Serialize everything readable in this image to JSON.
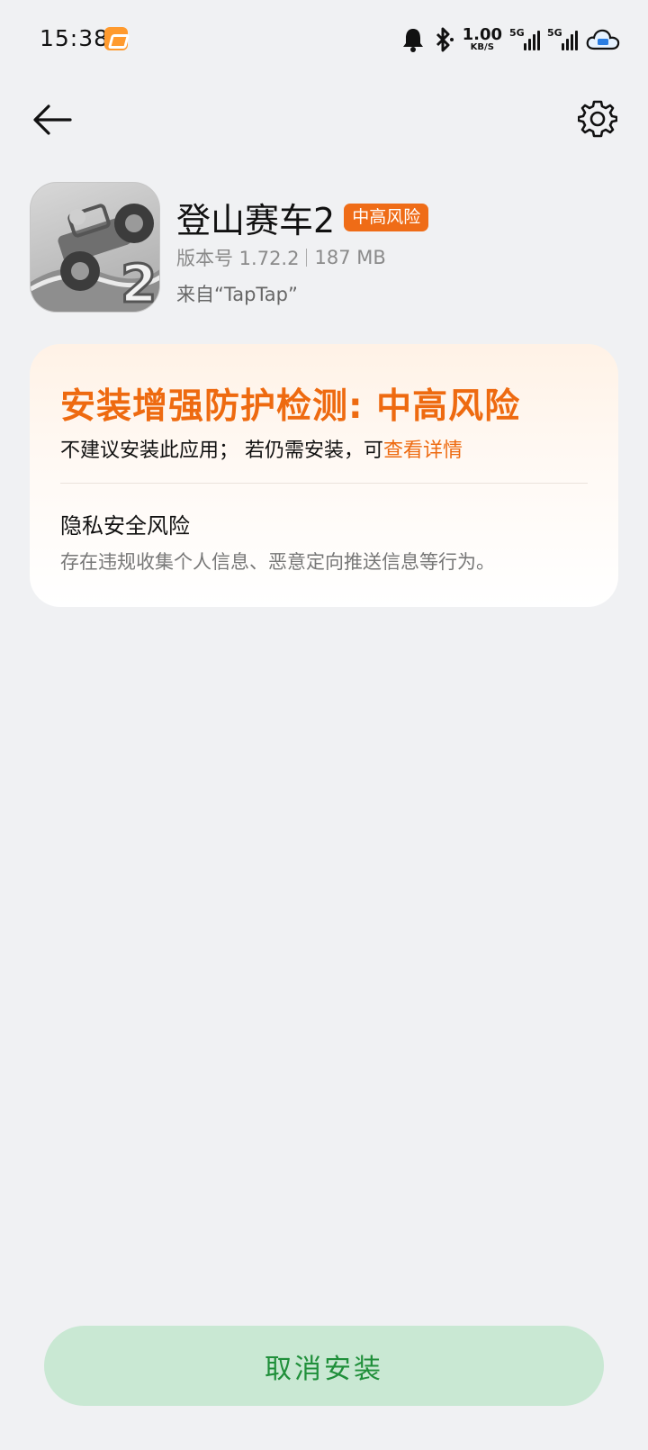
{
  "status_bar": {
    "time": "15:38",
    "net_speed_value": "1.00",
    "net_speed_unit": "KB/S",
    "sim1": "5G",
    "sim2": "5G",
    "icons": [
      "notification-app-icon",
      "alarm-bell-icon",
      "bluetooth-icon",
      "signal-icon",
      "signal-icon",
      "cloud-icon"
    ]
  },
  "nav": {
    "back_icon": "back-arrow-icon",
    "settings_icon": "gear-icon"
  },
  "app": {
    "name": "登山赛车2",
    "risk_badge": "中高风险",
    "version_label": "版本号 1.72.2",
    "size": "187 MB",
    "source": "来自“TapTap”"
  },
  "risk_card": {
    "title": "安装增强防护检测: 中高风险",
    "subtitle": "不建议安装此应用； 若仍需安装，可",
    "detail_link": "查看详情",
    "section_title": "隐私安全风险",
    "section_desc": "存在违规收集个人信息、恶意定向推送信息等行为。"
  },
  "actions": {
    "cancel_label": "取消安装"
  },
  "colors": {
    "accent_orange": "#ee6a10",
    "button_bg": "#c9e8d3",
    "button_text": "#1f8f3a",
    "page_bg": "#f0f1f3"
  }
}
